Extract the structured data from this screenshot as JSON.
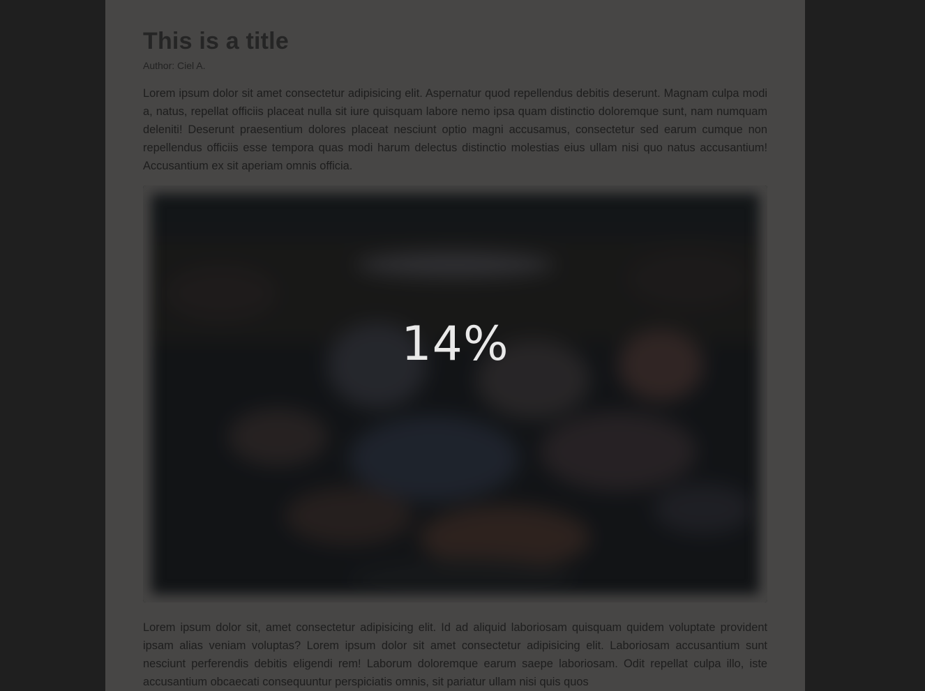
{
  "article": {
    "title": "This is a title",
    "author": "Author: Ciel A.",
    "paragraph_1": "Lorem ipsum dolor sit amet consectetur adipisicing elit. Aspernatur quod repellendus debitis deserunt. Magnam culpa modi a, natus, repellat officiis placeat nulla sit iure quisquam labore nemo ipsa quam distinctio doloremque sunt, nam numquam deleniti! Deserunt praesentium dolores placeat nesciunt optio magni accusamus, consectetur sed earum cumque non repellendus officiis esse tempora quas modi harum delectus distinctio molestias eius ullam nisi quo natus accusantium! Accusantium ex sit aperiam omnis officia.",
    "paragraph_2": "Lorem ipsum dolor sit, amet consectetur adipisicing elit. Id ad aliquid laboriosam quisquam quidem voluptate provident ipsam alias veniam voluptas? Lorem ipsum dolor sit amet consectetur adipisicing elit. Laboriosam accusantium sunt nesciunt perferendis debitis eligendi rem! Laborum doloremque earum saepe laboriosam. Odit repellat culpa illo, iste accusantium obcaecati consequuntur perspiciatis omnis, sit pariatur ullam nisi quis quos"
  },
  "image_loader": {
    "progress_text": "14%",
    "progress_value": 0.14
  },
  "colors": {
    "outer_background": "#1f1f1f",
    "page_background": "#474645",
    "image_background": "#1b1d20",
    "progress_text": "#e9e9e9"
  }
}
